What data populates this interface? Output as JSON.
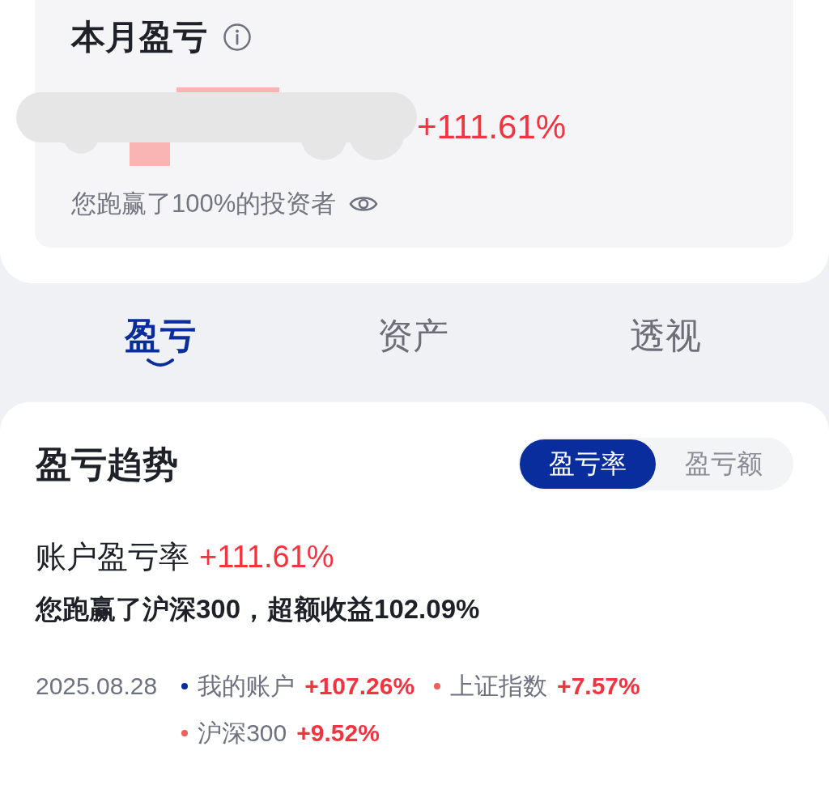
{
  "summary_card": {
    "title": "本月盈亏",
    "change": "+111.61%",
    "rank_text": "您跑赢了100%的投资者"
  },
  "tabs": [
    {
      "label": "盈亏",
      "selected": true
    },
    {
      "label": "资产",
      "selected": false
    },
    {
      "label": "透视",
      "selected": false
    }
  ],
  "trend_card": {
    "title": "盈亏趋势",
    "toggle": [
      {
        "label": "盈亏率",
        "selected": true
      },
      {
        "label": "盈亏额",
        "selected": false
      }
    ],
    "rate_label": "账户盈亏率",
    "rate_value": "+111.61%",
    "comparison": "您跑赢了沪深300，超额收益102.09%",
    "legend": {
      "date": "2025.08.28",
      "items": [
        {
          "name": "我的账户",
          "value": "+107.26%",
          "color": "#0a2d9e"
        },
        {
          "name": "上证指数",
          "value": "+7.57%",
          "color": "#f25c5c"
        },
        {
          "name": "沪深300",
          "value": "+9.52%",
          "color": "#f25c5c"
        }
      ]
    }
  }
}
